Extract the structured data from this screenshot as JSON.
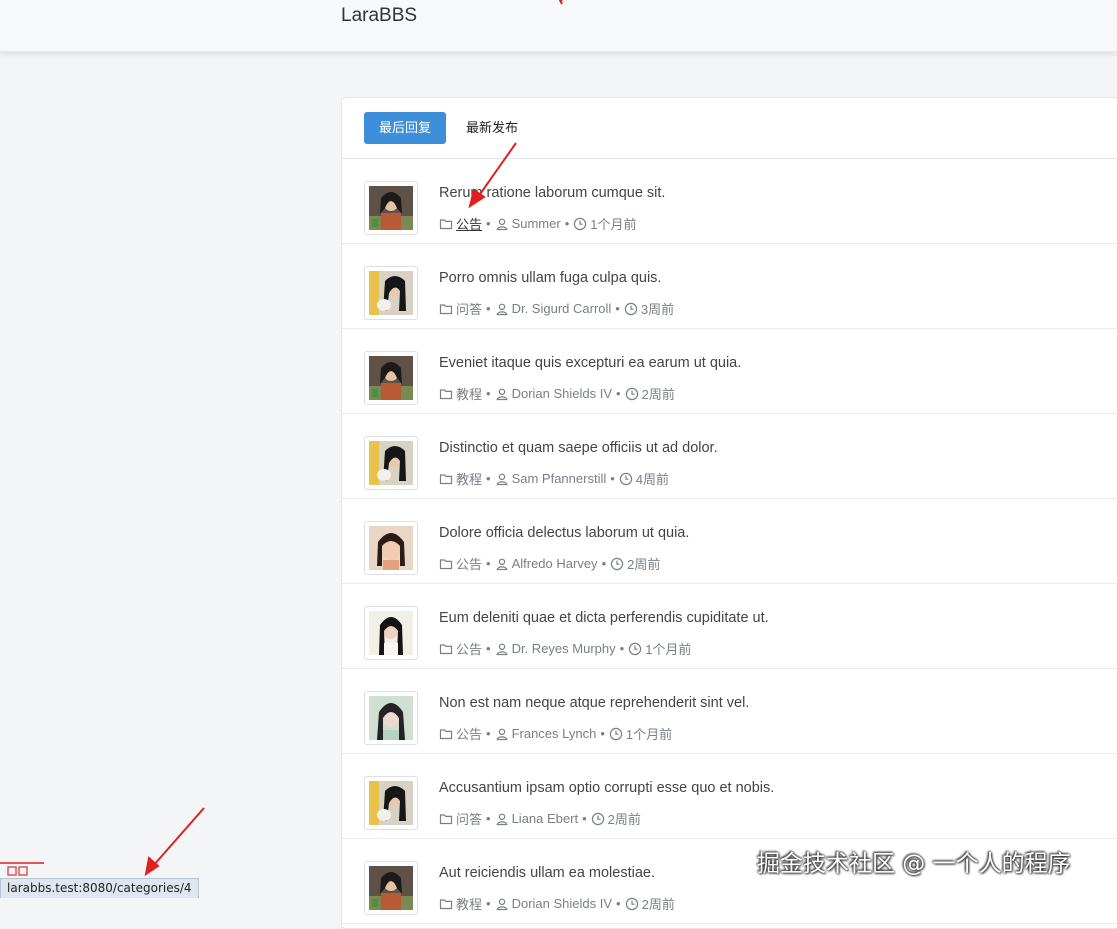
{
  "navbar": {
    "brand": "LaraBBS"
  },
  "tabs": [
    {
      "label": "最后回复",
      "active": true
    },
    {
      "label": "最新发布",
      "active": false
    }
  ],
  "topics": [
    {
      "title": "Rerum ratione laborum cumque sit.",
      "category": "公告",
      "author": "Summer",
      "time": "1个月前",
      "avatar": "avatar-a"
    },
    {
      "title": "Porro omnis ullam fuga culpa quis.",
      "category": "问答",
      "author": "Dr. Sigurd Carroll",
      "time": "3周前",
      "avatar": "avatar-b"
    },
    {
      "title": "Eveniet itaque quis excepturi ea earum ut quia.",
      "category": "教程",
      "author": "Dorian Shields IV",
      "time": "2周前",
      "avatar": "avatar-a"
    },
    {
      "title": "Distinctio et quam saepe officiis ut ad dolor.",
      "category": "教程",
      "author": "Sam Pfannerstill",
      "time": "4周前",
      "avatar": "avatar-b"
    },
    {
      "title": "Dolore officia delectus laborum ut quia.",
      "category": "公告",
      "author": "Alfredo Harvey",
      "time": "2周前",
      "avatar": "avatar-c"
    },
    {
      "title": "Eum deleniti quae et dicta perferendis cupiditate ut.",
      "category": "公告",
      "author": "Dr. Reyes Murphy",
      "time": "1个月前",
      "avatar": "avatar-d"
    },
    {
      "title": "Non est nam neque atque reprehenderit sint vel.",
      "category": "公告",
      "author": "Frances Lynch",
      "time": "1个月前",
      "avatar": "avatar-e"
    },
    {
      "title": "Accusantium ipsam optio corrupti esse quo et nobis.",
      "category": "问答",
      "author": "Liana Ebert",
      "time": "2周前",
      "avatar": "avatar-b"
    },
    {
      "title": "Aut reiciendis ullam ea molestiae.",
      "category": "教程",
      "author": "Dorian Shields IV",
      "time": "2周前",
      "avatar": "avatar-a"
    }
  ],
  "statusbar": {
    "url": "larabbs.test:8080/categories/4"
  },
  "watermark": "掘金技术社区 @ 一个人的程序",
  "colors": {
    "accent": "#3d8fd9",
    "annotation": "#e02020"
  }
}
